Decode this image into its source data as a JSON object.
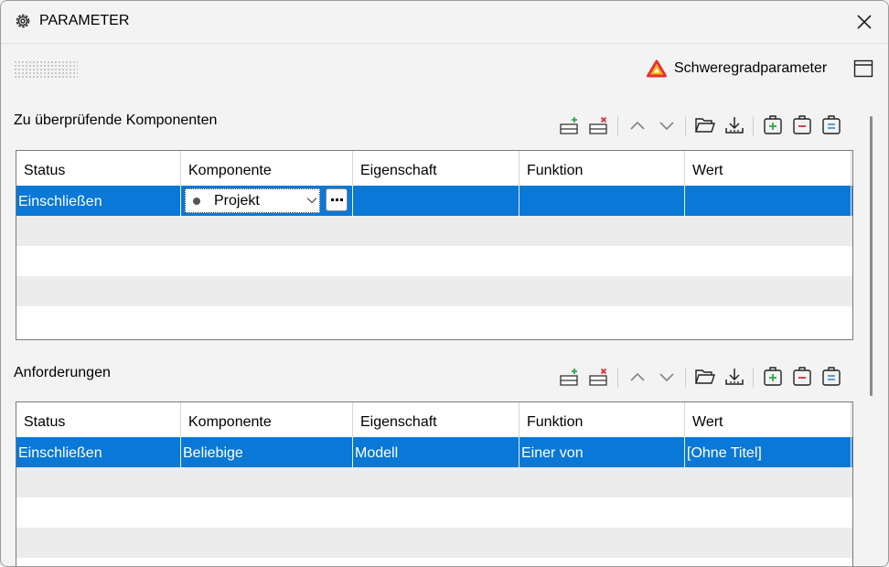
{
  "window": {
    "title": "PARAMETER"
  },
  "toolbar": {
    "severity_label": "Schweregradparameter"
  },
  "colors": {
    "selection": "#0a78d7",
    "warning_outer": "#e8302c",
    "warning_inner": "#f5b400",
    "add": "#2aa84a",
    "remove": "#d32f2f",
    "edit": "#2d7fd3"
  },
  "section1": {
    "title": "Zu überprüfende Komponenten",
    "columns": [
      "Status",
      "Komponente",
      "Eigenschaft",
      "Funktion",
      "Wert"
    ],
    "selected_row": {
      "status": "Einschließen",
      "component": "Projekt",
      "property": "",
      "function": "",
      "value": ""
    }
  },
  "section2": {
    "title": "Anforderungen",
    "columns": [
      "Status",
      "Komponente",
      "Eigenschaft",
      "Funktion",
      "Wert"
    ],
    "selected_row": {
      "status": "Einschließen",
      "component": "Beliebige",
      "property": "Modell",
      "function": "Einer von",
      "value": "[Ohne Titel]"
    }
  },
  "icons": [
    "add-row-icon",
    "delete-row-icon",
    "move-up-icon",
    "move-down-icon",
    "open-folder-icon",
    "import-icon",
    "add-item-icon",
    "remove-item-icon",
    "edit-item-icon"
  ]
}
